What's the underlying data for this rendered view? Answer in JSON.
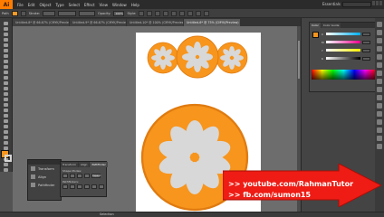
{
  "app": {
    "logo": "Ai",
    "menu": [
      "File",
      "Edit",
      "Object",
      "Type",
      "Select",
      "Effect",
      "View",
      "Window",
      "Help"
    ],
    "workspace": "Essentials"
  },
  "controlbar": {
    "selection_label": "Path",
    "stroke_label": "Stroke:",
    "opacity_label": "Opacity:",
    "opacity_value": "100%",
    "style_label": "Style:",
    "basic_label": "Basic",
    "fill_color": "#f89a27"
  },
  "tabs": [
    {
      "label": "Untitled-8* @ 66.67% (CMYK/Preview)",
      "active": false
    },
    {
      "label": "Untitled-9* @ 66.67% (CMYK/Preview)",
      "active": false
    },
    {
      "label": "Untitled-10* @ 100% (CMYK/Preview)",
      "active": false
    },
    {
      "label": "Untitled-6* @ 75% (CMYK/Preview)",
      "active": true
    }
  ],
  "toolbar": {
    "tools": [
      "selection",
      "direct-selection",
      "magic-wand",
      "lasso",
      "pen",
      "type",
      "line",
      "rectangle",
      "paintbrush",
      "pencil",
      "blob-brush",
      "eraser",
      "rotate",
      "scale",
      "width",
      "free-transform",
      "shape-builder",
      "perspective",
      "mesh",
      "gradient",
      "eyedropper",
      "blend",
      "symbol-sprayer",
      "column-graph",
      "artboard",
      "slice",
      "hand",
      "zoom"
    ],
    "fill": "#f7951d",
    "stroke": "none"
  },
  "floating_panel": {
    "items": [
      {
        "label": "Transform"
      },
      {
        "label": "Align"
      },
      {
        "label": "Pathfinder"
      }
    ]
  },
  "pathfinder": {
    "tabs": [
      "Transform",
      "Align",
      "Pathfinder"
    ],
    "shape_modes_label": "Shape Modes:",
    "pathfinders_label": "Pathfinders:",
    "expand_label": "Expand"
  },
  "color_panel": {
    "tabs": [
      "Color",
      "Color Guide"
    ],
    "channels": [
      "C",
      "M",
      "Y",
      "K"
    ]
  },
  "artwork": {
    "orange_color": "#f7951d",
    "orange_stroke": "#e07b10",
    "segment_color": "#d8d8d8"
  },
  "status": {
    "text": "Selection"
  },
  "promo": {
    "line1": ">> youtube.com/RahmanTutor",
    "line2": ">> fb.com/sumon15",
    "arrow_color": "#ee1c14"
  }
}
